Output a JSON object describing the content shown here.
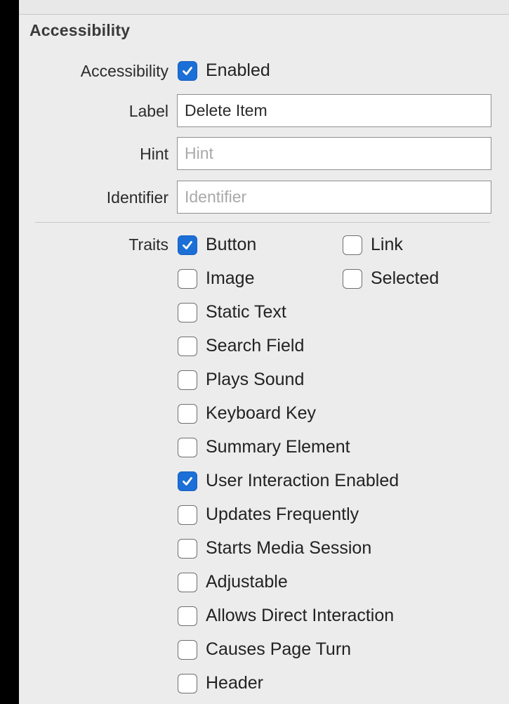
{
  "section": {
    "title": "Accessibility"
  },
  "accessibility_row": {
    "label": "Accessibility",
    "enabled_label": "Enabled",
    "enabled_checked": true
  },
  "label_row": {
    "label": "Label",
    "value": "Delete Item"
  },
  "hint_row": {
    "label": "Hint",
    "placeholder": "Hint"
  },
  "identifier_row": {
    "label": "Identifier",
    "placeholder": "Identifier"
  },
  "traits": {
    "label": "Traits",
    "items": [
      {
        "label": "Button",
        "checked": true
      },
      {
        "label": "Link",
        "checked": false
      },
      {
        "label": "Image",
        "checked": false
      },
      {
        "label": "Selected",
        "checked": false
      },
      {
        "label": "Static Text",
        "checked": false
      },
      {
        "label": "Search Field",
        "checked": false
      },
      {
        "label": "Plays Sound",
        "checked": false
      },
      {
        "label": "Keyboard Key",
        "checked": false
      },
      {
        "label": "Summary Element",
        "checked": false
      },
      {
        "label": "User Interaction Enabled",
        "checked": true
      },
      {
        "label": "Updates Frequently",
        "checked": false
      },
      {
        "label": "Starts Media Session",
        "checked": false
      },
      {
        "label": "Adjustable",
        "checked": false
      },
      {
        "label": "Allows Direct Interaction",
        "checked": false
      },
      {
        "label": "Causes Page Turn",
        "checked": false
      },
      {
        "label": "Header",
        "checked": false
      }
    ]
  },
  "colors": {
    "checkbox_checked": "#1b6fd6",
    "panel_bg": "#ececec",
    "window_bg": "#000000"
  }
}
